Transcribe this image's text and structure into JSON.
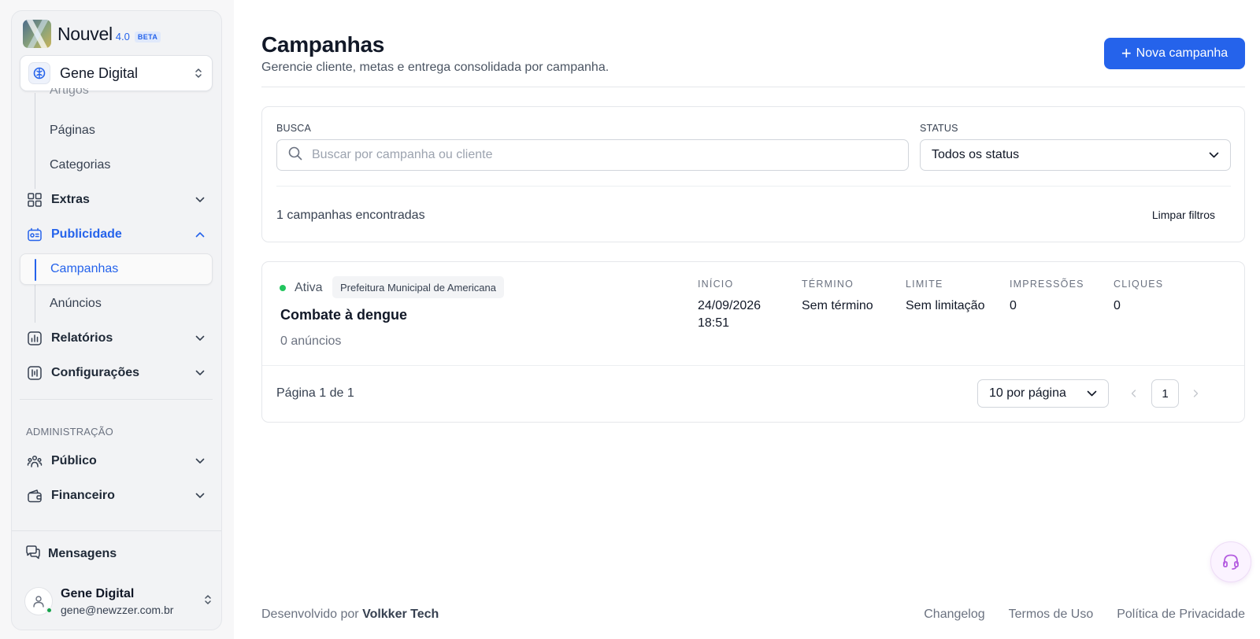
{
  "brand": {
    "name": "Nouvel",
    "version": "4.0",
    "badge": "BETA"
  },
  "workspace": {
    "name": "Gene Digital"
  },
  "sidebar": {
    "partial_item": "Artigos",
    "items": [
      {
        "label": "Páginas",
        "kind": "sub"
      },
      {
        "label": "Categorias",
        "kind": "sub"
      },
      {
        "label": "Extras",
        "kind": "group",
        "icon": "grid-icon",
        "expanded": false
      },
      {
        "label": "Publicidade",
        "kind": "group",
        "icon": "ad-icon",
        "expanded": true,
        "active": true
      },
      {
        "label": "Campanhas",
        "kind": "sub",
        "selected": true
      },
      {
        "label": "Anúncios",
        "kind": "sub"
      },
      {
        "label": "Relatórios",
        "kind": "group",
        "icon": "bar-chart-icon",
        "expanded": false
      },
      {
        "label": "Configurações",
        "kind": "group",
        "icon": "settings-sliders-icon",
        "expanded": false
      }
    ],
    "admin_section": "ADMINISTRAÇÃO",
    "admin_items": [
      {
        "label": "Público",
        "icon": "users-icon"
      },
      {
        "label": "Financeiro",
        "icon": "wallet-icon"
      }
    ],
    "messages": "Mensagens",
    "user": {
      "name": "Gene Digital",
      "email": "gene@newzzer.com.br",
      "online": true
    }
  },
  "page": {
    "title": "Campanhas",
    "subtitle": "Gerencie cliente, metas e entrega consolidada por campanha.",
    "new_button": "Nova campanha"
  },
  "filters": {
    "search_label": "BUSCA",
    "search_placeholder": "Buscar por campanha ou cliente",
    "status_label": "STATUS",
    "status_value": "Todos os status",
    "count_text": "1 campanhas encontradas",
    "clear_label": "Limpar filtros"
  },
  "campaigns": [
    {
      "status": "Ativa",
      "client": "Prefeitura Municipal de Americana",
      "name": "Combate à dengue",
      "ads": "0 anúncios",
      "inicio_label": "INÍCIO",
      "inicio_date": "24/09/2026",
      "inicio_time": "18:51",
      "termino_label": "TÉRMINO",
      "termino": "Sem término",
      "limite_label": "LIMITE",
      "limite": "Sem limitação",
      "impressoes_label": "IMPRESSÕES",
      "impressoes": "0",
      "cliques_label": "CLIQUES",
      "cliques": "0"
    }
  ],
  "pagination": {
    "info": "Página 1 de 1",
    "per_page": "10 por página",
    "current": "1"
  },
  "footer": {
    "prefix": "Desenvolvido por",
    "company": "Volkker Tech",
    "links": [
      "Changelog",
      "Termos de Uso",
      "Política de Privacidade"
    ]
  },
  "colors": {
    "accent": "#2563eb",
    "active_dot": "#22c55e",
    "online": "#16a34a"
  }
}
